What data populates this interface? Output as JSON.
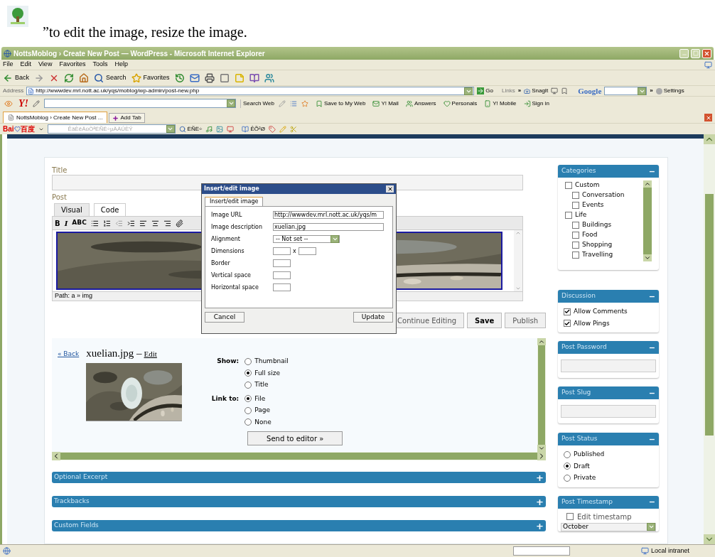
{
  "document": {
    "caption": "”to edit the image, resize the image."
  },
  "browser": {
    "title": "NottsMoblog › Create New Post — WordPress - Microsoft Internet Explorer",
    "menu": [
      "File",
      "Edit",
      "View",
      "Favorites",
      "Tools",
      "Help"
    ],
    "toolbar": [
      {
        "kind": "back",
        "label": "Back"
      },
      {
        "kind": "forward"
      },
      {
        "kind": "stop"
      },
      {
        "kind": "refresh"
      },
      {
        "kind": "home"
      },
      {
        "kind": "search",
        "label": "Search"
      },
      {
        "kind": "favorites",
        "label": "Favorites"
      },
      {
        "kind": "history"
      },
      {
        "kind": "mail"
      },
      {
        "kind": "print"
      },
      {
        "kind": "square"
      },
      {
        "kind": "note"
      },
      {
        "kind": "book"
      },
      {
        "kind": "people"
      }
    ],
    "address": {
      "label": "Address",
      "url": "http://wwwdev.mrl.nott.ac.uk/yqs/moblog/wp-admin/post-new.php",
      "go": "Go",
      "links": "Links",
      "more": "»",
      "snagit": "SnagIt",
      "google": "Google",
      "google_more": "»",
      "settings": "Settings"
    },
    "yahoo": {
      "logo": "Y!",
      "search": "Search Web",
      "items": [
        "Save to My Web",
        "Y! Mail",
        "Answers",
        "Personals",
        "Y! Mobile",
        "Sign in"
      ]
    },
    "tabs": [
      {
        "label": "NottsMoblog › Create New Post ...",
        "selected": true
      }
    ],
    "add_tab": "Add Tab",
    "baidu": {
      "logo_latin": "Bai",
      "logo_cjk": "百度",
      "search_placeholder": "ÊäÈëÄúÒªËÑË÷µÄÄÚÈÝ",
      "search_button": "ËÑË÷",
      "collect": "ÊÕ²Ø"
    }
  },
  "page": {
    "title_label": "Title",
    "post_label": "Post",
    "editor_tabs": [
      {
        "label": "Visual",
        "selected": true
      },
      {
        "label": "Code",
        "selected": false
      }
    ],
    "format_buttons": [
      "B",
      "I",
      "ABC"
    ],
    "path": "Path: a » img",
    "actions": [
      {
        "label": "Continue Editing",
        "kind": "default"
      },
      {
        "label": "Save",
        "kind": "primary"
      },
      {
        "label": "Publish",
        "kind": "default"
      }
    ],
    "gallery": {
      "back": "« Back",
      "file": "xuelian.jpg –",
      "edit": "Edit",
      "send": "Send to editor »",
      "groups": [
        {
          "label": "Show:",
          "options": [
            {
              "label": "Thumbnail",
              "selected": false
            },
            {
              "label": "Full size",
              "selected": true
            },
            {
              "label": "Title",
              "selected": false
            }
          ]
        },
        {
          "label": "Link to:",
          "options": [
            {
              "label": "File",
              "selected": true
            },
            {
              "label": "Page",
              "selected": false
            },
            {
              "label": "None",
              "selected": false
            }
          ]
        }
      ]
    },
    "sections": [
      {
        "label": "Optional Excerpt",
        "toggle": "+"
      },
      {
        "label": "Trackbacks",
        "toggle": "+"
      },
      {
        "label": "Custom Fields",
        "toggle": "+"
      }
    ]
  },
  "sidebar": [
    {
      "kind": "categories",
      "title": "Categories",
      "toggle": "−",
      "items": [
        {
          "label": "Custom",
          "checked": false,
          "children": [
            {
              "label": "Conversation",
              "checked": false
            },
            {
              "label": "Events",
              "checked": false
            }
          ]
        },
        {
          "label": "Life",
          "checked": false,
          "children": [
            {
              "label": "Buildings",
              "checked": false
            },
            {
              "label": "Food",
              "checked": false
            },
            {
              "label": "Shopping",
              "checked": false
            },
            {
              "label": "Travelling",
              "checked": false
            }
          ]
        }
      ]
    },
    {
      "kind": "checkboxes",
      "title": "Discussion",
      "toggle": "−",
      "items": [
        {
          "label": "Allow Comments",
          "checked": true
        },
        {
          "label": "Allow Pings",
          "checked": true
        }
      ]
    },
    {
      "kind": "field",
      "title": "Post Password",
      "toggle": "−"
    },
    {
      "kind": "field",
      "title": "Post Slug",
      "toggle": "−"
    },
    {
      "kind": "radios",
      "title": "Post Status",
      "toggle": "−",
      "items": [
        {
          "label": "Published",
          "selected": false
        },
        {
          "label": "Draft",
          "selected": true
        },
        {
          "label": "Private",
          "selected": false
        }
      ]
    },
    {
      "kind": "timestamp",
      "title": "Post Timestamp",
      "toggle": "−",
      "checkbox": {
        "label": "Edit timestamp",
        "checked": false
      },
      "month": "October"
    }
  ],
  "dialog": {
    "title": "Insert/edit image",
    "tab": "Insert/edit image",
    "fields": [
      {
        "kind": "text",
        "label": "Image URL",
        "value": "http://wwwdev.mrl.nott.ac.uk/yqs/m"
      },
      {
        "kind": "text",
        "label": "Image description",
        "value": "xuelian.jpg"
      },
      {
        "kind": "select",
        "label": "Alignment",
        "value": "-- Not set --"
      },
      {
        "kind": "pair",
        "label": "Dimensions",
        "separator": "x"
      },
      {
        "kind": "small",
        "label": "Border"
      },
      {
        "kind": "small",
        "label": "Vertical space"
      },
      {
        "kind": "small",
        "label": "Horizontal space"
      }
    ],
    "buttons": [
      "Cancel",
      "Update"
    ]
  },
  "status_bar": {
    "zone": "Local intranet"
  }
}
